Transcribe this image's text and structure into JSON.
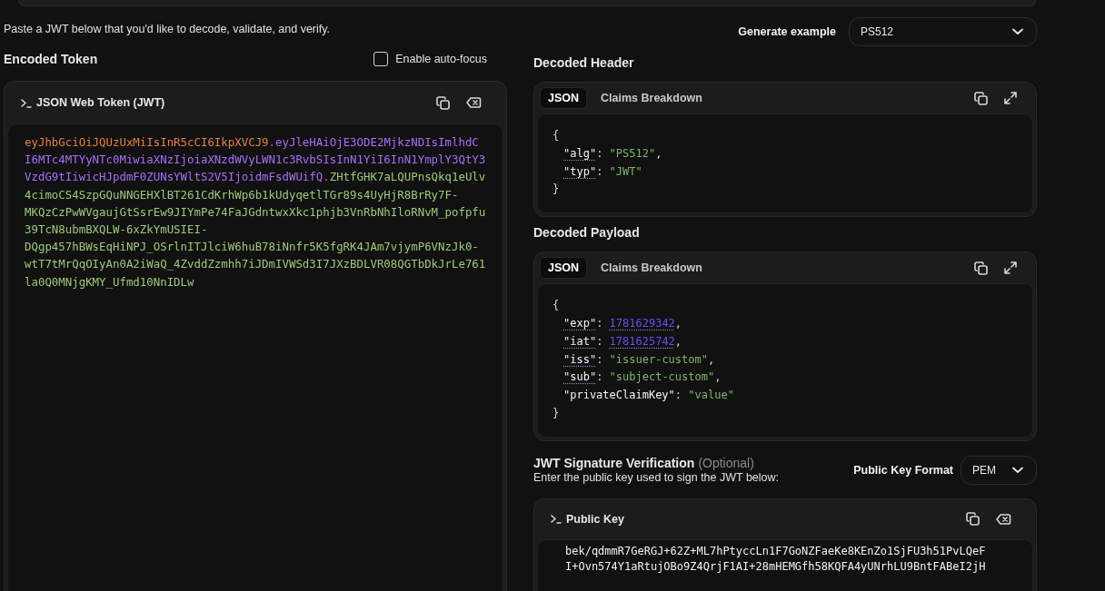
{
  "intro": "Paste a JWT below that you'd like to decode, validate, and verify.",
  "encoded": {
    "title": "Encoded Token",
    "autofocus": {
      "label": "Enable auto-focus",
      "checked": false
    },
    "editor": {
      "title": "JSON Web Token (JWT)",
      "segments": [
        {
          "kind": "header",
          "text": "eyJhbGciOiJQUzUxMiIsInR5cCI6IkpXVCJ9"
        },
        {
          "kind": "separator",
          "text": "."
        },
        {
          "kind": "payload",
          "text": "eyJleHAiOjE3ODE2MjkzNDIsImlhdCI6MTc4MTYyNTc0MiwiaXNzIjoiaXNzdWVyLWN1c3RvbSIsInN1YiI6InN1YmplY3QtY3VzdG9tIiwicHJpdmF0ZUNsYWltS2V5IjoidmFsdWUifQ"
        },
        {
          "kind": "separator",
          "text": "."
        },
        {
          "kind": "signature",
          "text": "ZHtfGHK7aLQUPnsQkq1eUlv4cimoCS4SzpGQuNNGEHXlBT261CdKrhWp6b1kUdyqetlTGr89s4UyHjR8BrRy7F-MKQzCzPwWVgaujGtSsrEw9JIYmPe74FaJGdntwxXkc1phjb3VnRbNhIloRNvM_pofpfu39TcN8ubmBXQLW-6xZkYmUSIEI-DQgp457hBWsEqHiNPJ_OSrlnITJlciW6huB78iNnfr5K5fgRK4JAm7vjymP6VNzJk0-wtT7tMrQqOIyAn0A2iWaQ_4ZvddZzmhh7iJDmIVWSd3I7JXzBDLVR08QGTbDkJrLe761la0Q0MNjgKMY_Ufmd10NnIDLw"
        }
      ]
    }
  },
  "generate": {
    "label": "Generate example",
    "value": "PS512"
  },
  "decoded": [
    {
      "title": "Decoded Header",
      "tabs": [
        {
          "label": "JSON",
          "selected": true
        },
        {
          "label": "Claims Breakdown",
          "selected": false
        }
      ],
      "lines": [
        {
          "kind": "brace",
          "text": "{"
        },
        {
          "kind": "string",
          "key": "\"alg\"",
          "sep": ": ",
          "value": "\"PS512\"",
          "end": ",",
          "hinted": true
        },
        {
          "kind": "string",
          "key": "\"typ\"",
          "sep": ": ",
          "value": "\"JWT\"",
          "hinted": true
        },
        {
          "kind": "brace",
          "text": "}"
        }
      ]
    },
    {
      "title": "Decoded Payload",
      "tabs": [
        {
          "label": "JSON",
          "selected": true
        },
        {
          "label": "Claims Breakdown",
          "selected": false
        }
      ],
      "lines": [
        {
          "kind": "brace",
          "text": "{"
        },
        {
          "kind": "number",
          "key": "\"exp\"",
          "sep": ": ",
          "value": "1781629342",
          "end": ",",
          "hinted": true
        },
        {
          "kind": "number",
          "key": "\"iat\"",
          "sep": ": ",
          "value": "1781625742",
          "end": ",",
          "hinted": true
        },
        {
          "kind": "string",
          "key": "\"iss\"",
          "sep": ": ",
          "value": "\"issuer-custom\"",
          "end": ",",
          "hinted": true
        },
        {
          "kind": "string",
          "key": "\"sub\"",
          "sep": ": ",
          "value": "\"subject-custom\"",
          "end": ",",
          "hinted": true
        },
        {
          "kind": "string",
          "key": "\"privateClaimKey\"",
          "sep": ": ",
          "value": "\"value\"",
          "hinted": false
        },
        {
          "kind": "brace",
          "text": "}"
        }
      ]
    }
  ],
  "signature": {
    "title": "JWT Signature Verification",
    "note": "(Optional)",
    "subtitle": "Enter the public key used to sign the JWT below:",
    "format": {
      "label": "Public Key Format",
      "value": "PEM"
    },
    "editor": {
      "title": "Public Key",
      "lines": [
        "bek/qdmmR7GeRGJ+62Z+ML7hPtyccLn1F7GoNZFaeKe8KEnZo1SjFU3h51PvLQeF",
        "I+Ovn574Y1aRtujOBo9Z4QrjF1AI+28mHEMGfh58KQFA4yUNrhLU9BntFABeI2jH"
      ]
    }
  }
}
